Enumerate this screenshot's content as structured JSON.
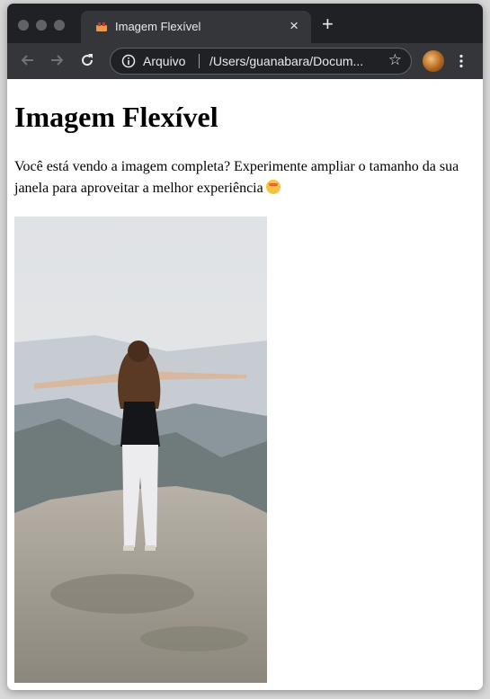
{
  "browser": {
    "tab": {
      "title": "Imagem Flexível",
      "close_glyph": "×",
      "favicon": "webpage-emoji-icon"
    },
    "new_tab_glyph": "+",
    "toolbar": {
      "back_icon": "arrow-left-icon",
      "forward_icon": "arrow-right-icon",
      "reload_icon": "reload-icon",
      "site_info_icon": "info-icon",
      "scheme_label": "Arquivo",
      "url": "/Users/guanabara/Docum...",
      "bookmark_glyph": "☆",
      "profile_icon": "avatar",
      "menu_icon": "kebab-menu-icon"
    },
    "colors": {
      "tabbar": "#202124",
      "toolbar": "#35363a",
      "text": "#e8eaed"
    }
  },
  "page": {
    "heading": "Imagem Flexível",
    "paragraph": "Você está vendo a imagem completa? Experimente ampliar o tamanho da sua janela para aproveitar a melhor experiência",
    "paragraph_emoji": "mind-blown-emoji-icon",
    "image": {
      "content": "woman-standing-on-rock-with-arms-outstretched"
    }
  }
}
